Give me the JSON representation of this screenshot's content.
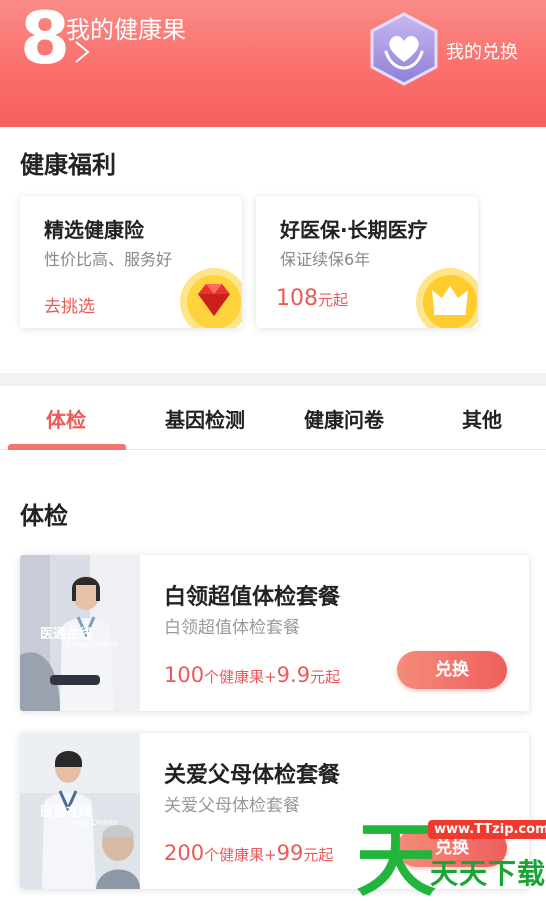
{
  "header": {
    "points": "8",
    "title": "我的健康果",
    "exchange_label": "我的兑换"
  },
  "welfare": {
    "title": "健康福利",
    "cards": [
      {
        "title": "精选健康险",
        "subtitle": "性价比高、服务好",
        "link": "去挑选",
        "badge_icon": "ruby-gem-icon"
      },
      {
        "title": "好医保·长期医疗",
        "subtitle": "保证续保6年",
        "price": "108",
        "price_unit": "元起",
        "badge_icon": "crown-icon"
      }
    ]
  },
  "tabs": {
    "items": [
      "体检",
      "基因检测",
      "健康问卷",
      "其他"
    ],
    "active": "体检"
  },
  "exam": {
    "title": "体检",
    "products": [
      {
        "title": "白领超值体检套餐",
        "subtitle": "白领超值体检套餐",
        "fruit": "100",
        "fruit_unit": "个健康果+",
        "cash": "9.9",
        "cash_unit": "元起",
        "button": "兑换",
        "photo_logo": "医通在线",
        "photo_logo_en": "Etong Online"
      },
      {
        "title": "关爱父母体检套餐",
        "subtitle": "关爱父母体检套餐",
        "fruit": "200",
        "fruit_unit": "个健康果+",
        "cash": "99",
        "cash_unit": "元起",
        "button": "兑换",
        "photo_logo": "医通在线",
        "photo_logo_en": "Etong Online"
      }
    ]
  },
  "watermark": {
    "url": "www.TTzip.com",
    "text": "天天下载"
  },
  "colors": {
    "accent": "#ec5a58",
    "header_gradient_top": "#f98b86",
    "header_gradient_bottom": "#f35f5f",
    "watermark_green": "#17a534"
  }
}
